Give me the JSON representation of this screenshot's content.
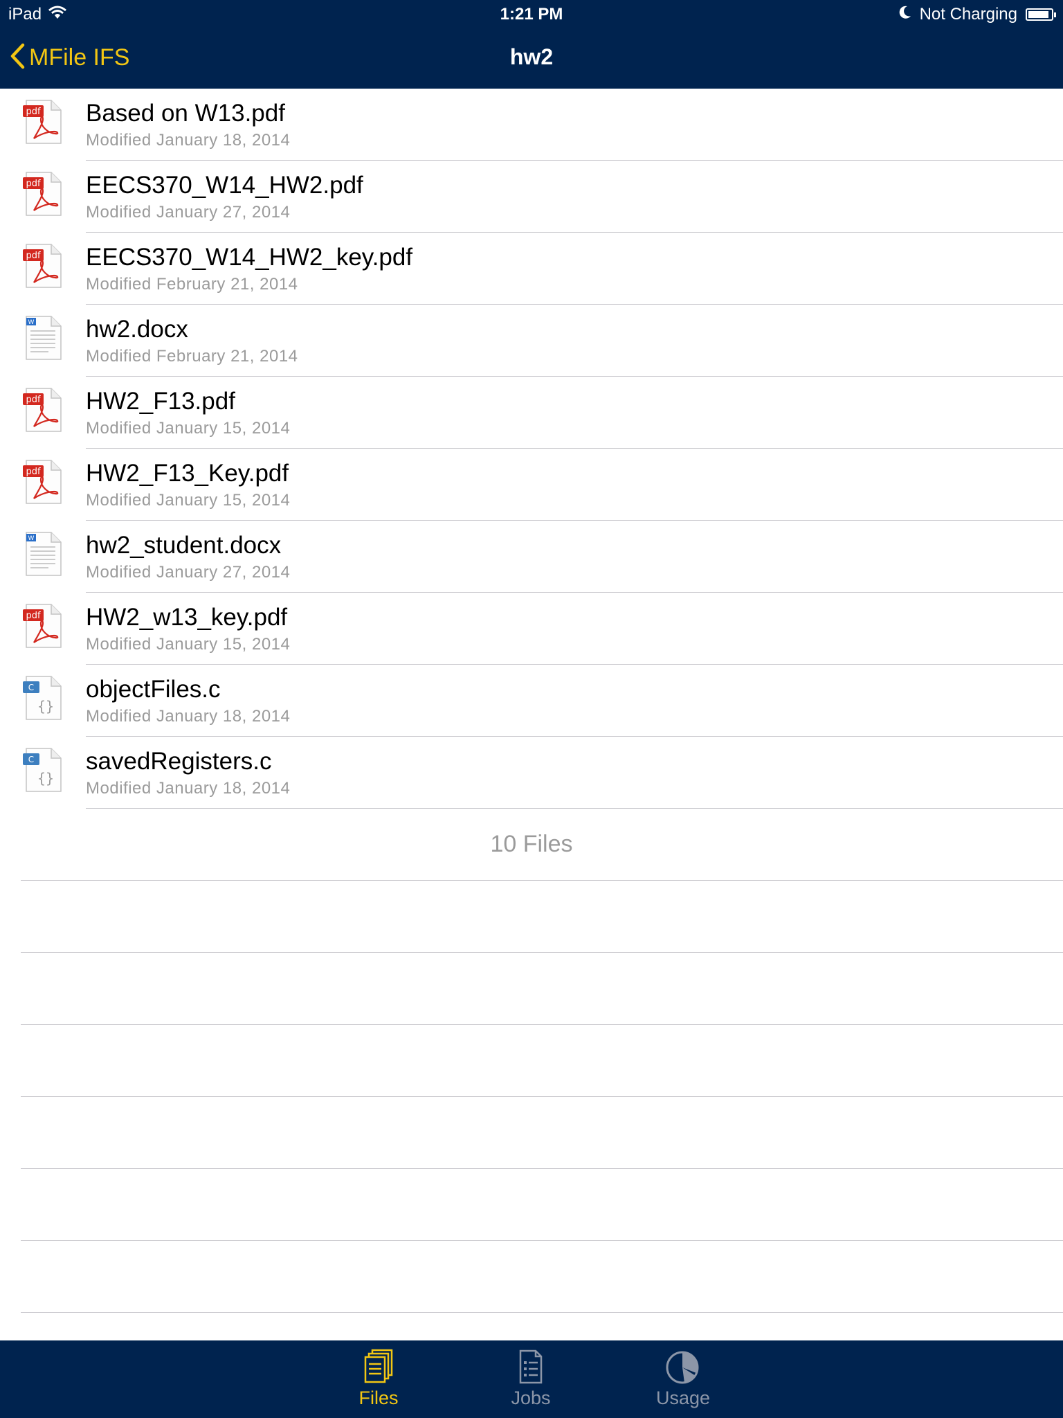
{
  "status_bar": {
    "device": "iPad",
    "time": "1:21 PM",
    "charging": "Not Charging",
    "battery_level": 0.9
  },
  "nav": {
    "back_label": "MFile IFS",
    "title": "hw2"
  },
  "files": [
    {
      "name": "Based on W13.pdf",
      "modified": "Modified January 18, 2014",
      "type": "pdf"
    },
    {
      "name": "EECS370_W14_HW2.pdf",
      "modified": "Modified January 27, 2014",
      "type": "pdf"
    },
    {
      "name": "EECS370_W14_HW2_key.pdf",
      "modified": "Modified February 21, 2014",
      "type": "pdf"
    },
    {
      "name": "hw2.docx",
      "modified": "Modified February 21, 2014",
      "type": "docx"
    },
    {
      "name": "HW2_F13.pdf",
      "modified": "Modified January 15, 2014",
      "type": "pdf"
    },
    {
      "name": "HW2_F13_Key.pdf",
      "modified": "Modified January 15, 2014",
      "type": "pdf"
    },
    {
      "name": "hw2_student.docx",
      "modified": "Modified January 27, 2014",
      "type": "docx"
    },
    {
      "name": "HW2_w13_key.pdf",
      "modified": "Modified January 15, 2014",
      "type": "pdf"
    },
    {
      "name": "objectFiles.c",
      "modified": "Modified January 18, 2014",
      "type": "c"
    },
    {
      "name": "savedRegisters.c",
      "modified": "Modified January 18, 2014",
      "type": "c"
    }
  ],
  "file_count": "10 Files",
  "tabs": [
    {
      "label": "Files",
      "icon": "files-icon",
      "active": true
    },
    {
      "label": "Jobs",
      "icon": "jobs-icon",
      "active": false
    },
    {
      "label": "Usage",
      "icon": "usage-icon",
      "active": false
    }
  ],
  "colors": {
    "bar_background": "#00234f",
    "accent": "#f2c613",
    "secondary_text": "#9b9b9b",
    "inactive_tab": "#8c96a8"
  }
}
